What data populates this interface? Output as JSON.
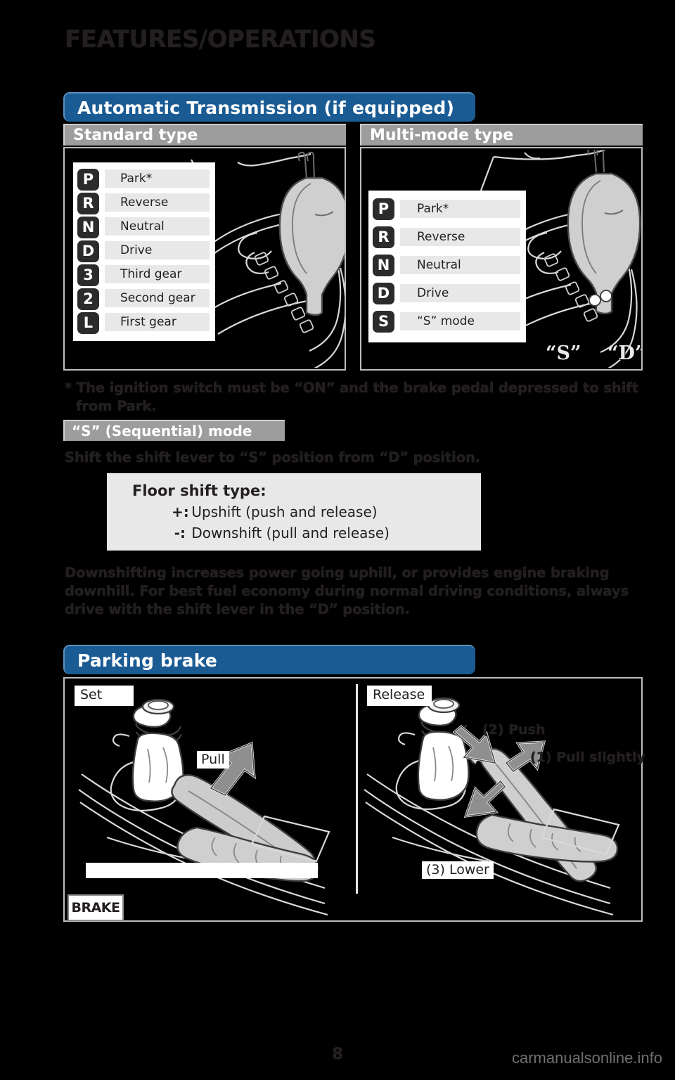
{
  "page": {
    "title": "FEATURES/OPERATIONS",
    "number": "8",
    "watermark": "carmanualsonline.info"
  },
  "colors": {
    "section_blue": "#1b5b94",
    "subheader_gray": "#9d9d9d",
    "panel_border": "#bdbdbd",
    "badge_dark": "#2b2b2b",
    "label_gray": "#e8e8e8",
    "text_dark": "#231f20"
  },
  "sections": {
    "automatic_transmission": {
      "heading": "Automatic Transmission (if equipped)",
      "standard": {
        "subheading": "Standard type",
        "gears": [
          {
            "badge": "P",
            "label": "Park*"
          },
          {
            "badge": "R",
            "label": "Reverse"
          },
          {
            "badge": "N",
            "label": "Neutral"
          },
          {
            "badge": "D",
            "label": "Drive"
          },
          {
            "badge": "3",
            "label": "Third gear"
          },
          {
            "badge": "2",
            "label": "Second gear"
          },
          {
            "badge": "L",
            "label": "First gear"
          }
        ]
      },
      "multi_mode": {
        "subheading": "Multi-mode type",
        "gears": [
          {
            "badge": "P",
            "label": "Park*"
          },
          {
            "badge": "R",
            "label": "Reverse"
          },
          {
            "badge": "N",
            "label": "Neutral"
          },
          {
            "badge": "D",
            "label": "Drive"
          },
          {
            "badge": "S",
            "label": "“S” mode"
          }
        ],
        "gate_markers": {
          "s": "“S”",
          "d": "“D”"
        }
      },
      "footnote_line1": "* The ignition switch must be “ON” and the brake pedal depressed to shift",
      "footnote_line2": "from Park."
    },
    "sequential_mode": {
      "heading": "“S” (Sequential) mode",
      "instruction": "Shift the shift lever to “S” position from “D” position.",
      "floor_shift": {
        "title": "Floor shift type:",
        "upshift_symbol": "+:",
        "upshift_text": "Upshift (push and release)",
        "downshift_symbol": "-:",
        "downshift_text": "Downshift (pull and release)"
      },
      "paragraph": "Downshifting increases power going uphill, or provides engine braking downhill. For best fuel economy during normal driving conditions, always drive with the shift lever in the “D” position."
    },
    "parking_brake": {
      "heading": "Parking brake",
      "set": {
        "tag": "Set",
        "callout": "Pull",
        "indicator_label": "BRAKE"
      },
      "release": {
        "tag": "Release",
        "callout_push": "(2) Push",
        "callout_pull_slightly": "(1) Pull slightly",
        "callout_lower": "(3) Lower"
      }
    }
  }
}
